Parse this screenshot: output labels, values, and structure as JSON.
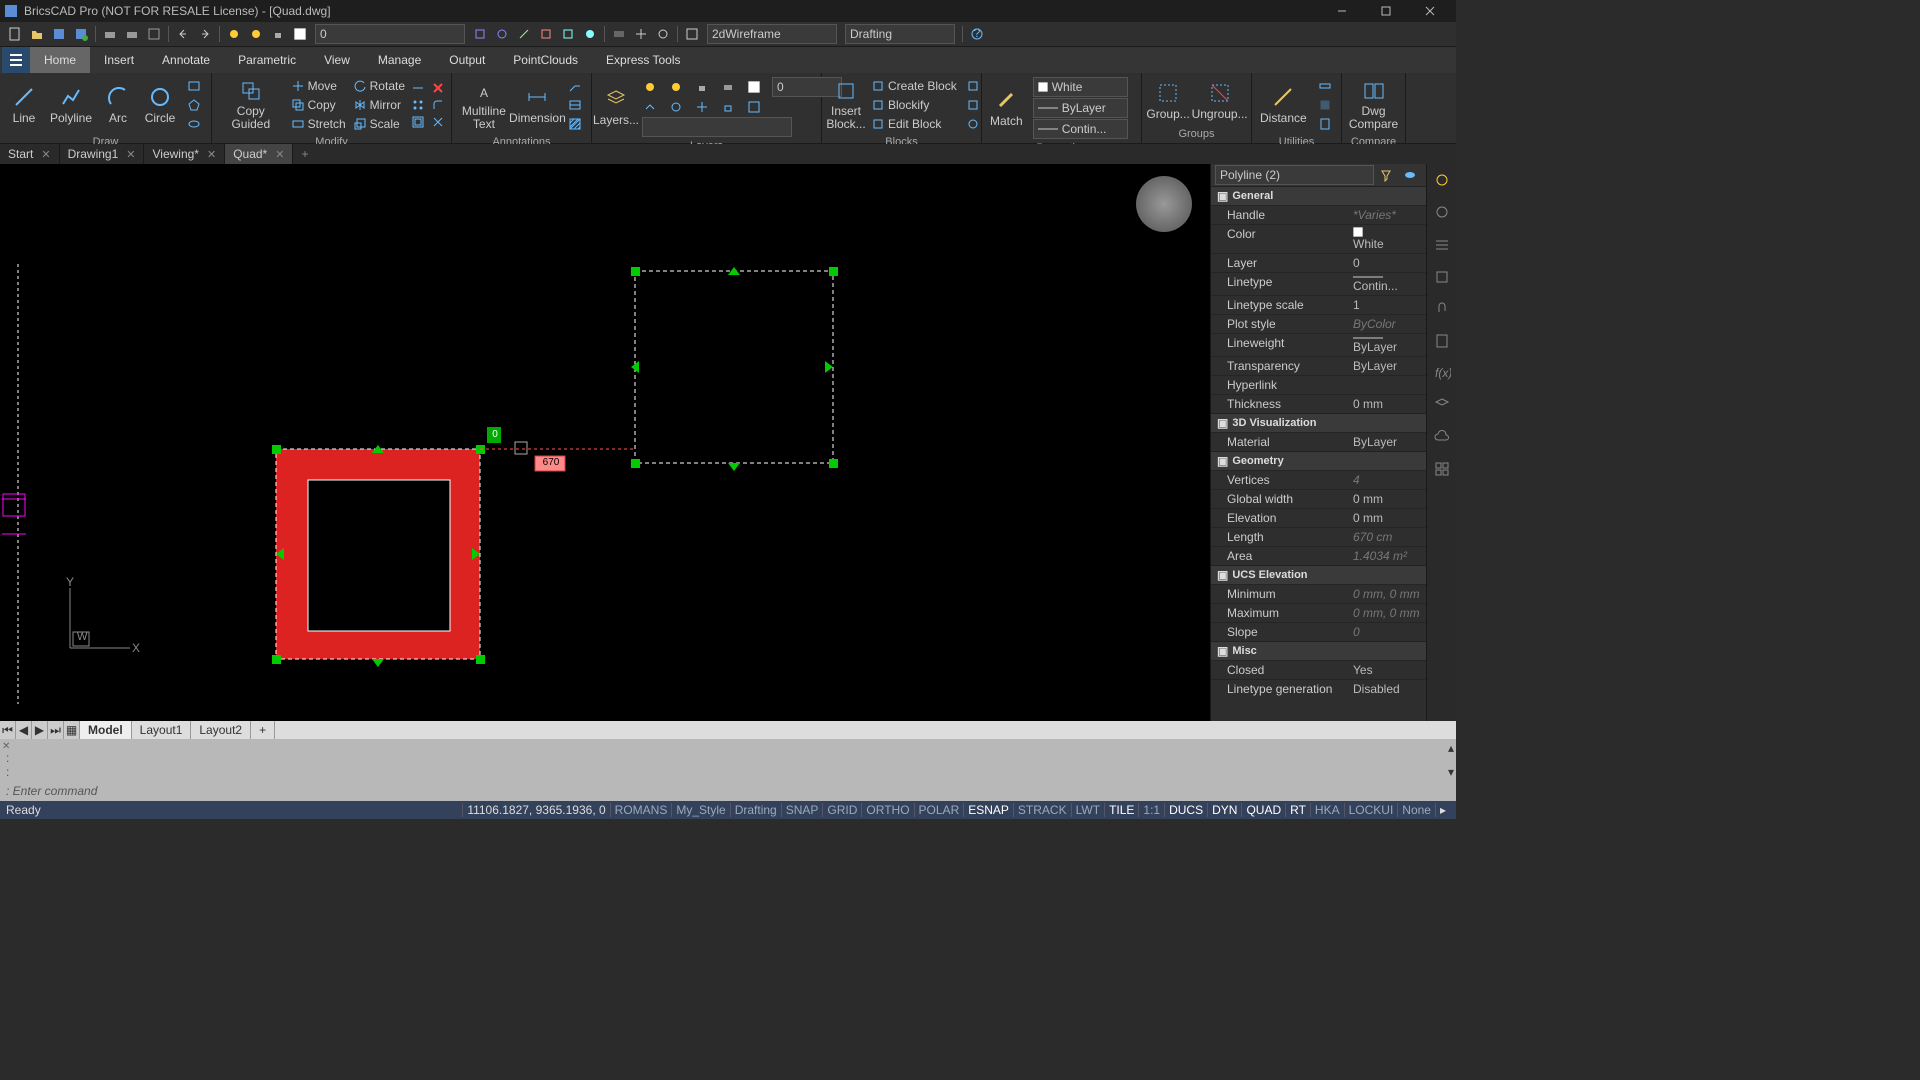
{
  "title": "BricsCAD Pro (NOT FOR RESALE License) - [Quad.dwg]",
  "qat": {
    "layer_dd": "0",
    "visual_style": "2dWireframe",
    "workspace": "Drafting"
  },
  "menus": [
    "Home",
    "Insert",
    "Annotate",
    "Parametric",
    "View",
    "Manage",
    "Output",
    "PointClouds",
    "Express Tools"
  ],
  "ribbon": {
    "draw": {
      "title": "Draw",
      "line": "Line",
      "polyline": "Polyline",
      "arc": "Arc",
      "circle": "Circle"
    },
    "modify": {
      "title": "Modify",
      "guided": "Copy Guided",
      "move": "Move",
      "rotate": "Rotate",
      "copy": "Copy",
      "mirror": "Mirror",
      "stretch": "Stretch",
      "scale": "Scale"
    },
    "annot": {
      "title": "Annotations",
      "mtext": "Multiline Text",
      "dim": "Dimension"
    },
    "layers": {
      "title": "Layers",
      "btn": "Layers...",
      "dd": "0"
    },
    "blocks": {
      "title": "Blocks",
      "insert": "Insert Block...",
      "create": "Create Block",
      "blockify": "Blockify",
      "edit": "Edit Block"
    },
    "match": {
      "label": "Match"
    },
    "props": {
      "title": "Properties",
      "color": "White",
      "ltype": "ByLayer",
      "lstyle": "Contin..."
    },
    "groups": {
      "title": "Groups",
      "group": "Group...",
      "ungroup": "Ungroup..."
    },
    "util": {
      "title": "Utilities",
      "distance": "Distance"
    },
    "compare": {
      "title": "Compare",
      "dwg": "Dwg Compare"
    }
  },
  "doc_tabs": [
    {
      "label": "Start",
      "closeable": true
    },
    {
      "label": "Drawing1",
      "closeable": true
    },
    {
      "label": "Viewing*",
      "closeable": true
    },
    {
      "label": "Quad*",
      "closeable": true,
      "active": true
    }
  ],
  "canvas": {
    "input_val": "0",
    "meas_val": "670",
    "ucs_label": "W"
  },
  "props": {
    "selection": "Polyline (2)",
    "groups": [
      {
        "name": "General",
        "rows": [
          {
            "k": "Handle",
            "v": "*Varies*",
            "varies": true
          },
          {
            "k": "Color",
            "v": "White",
            "swatch": true
          },
          {
            "k": "Layer",
            "v": "0"
          },
          {
            "k": "Linetype",
            "v": "Contin..."
          },
          {
            "k": "Linetype scale",
            "v": "1"
          },
          {
            "k": "Plot style",
            "v": "ByColor",
            "varies": true
          },
          {
            "k": "Lineweight",
            "v": "ByLayer"
          },
          {
            "k": "Transparency",
            "v": "ByLayer"
          },
          {
            "k": "Hyperlink",
            "v": ""
          },
          {
            "k": "Thickness",
            "v": "0 mm"
          }
        ]
      },
      {
        "name": "3D Visualization",
        "rows": [
          {
            "k": "Material",
            "v": "ByLayer"
          }
        ]
      },
      {
        "name": "Geometry",
        "rows": [
          {
            "k": "Vertices",
            "v": "4",
            "varies": true
          },
          {
            "k": "Global width",
            "v": "0 mm"
          },
          {
            "k": "Elevation",
            "v": "0 mm"
          },
          {
            "k": "Length",
            "v": "670 cm",
            "varies": true
          },
          {
            "k": "Area",
            "v": "1.4034 m²",
            "varies": true
          }
        ]
      },
      {
        "name": "UCS Elevation",
        "rows": [
          {
            "k": "Minimum",
            "v": "0 mm, 0 mm",
            "varies": true
          },
          {
            "k": "Maximum",
            "v": "0 mm, 0 mm",
            "varies": true
          },
          {
            "k": "Slope",
            "v": "0",
            "varies": true
          }
        ]
      },
      {
        "name": "Misc",
        "rows": [
          {
            "k": "Closed",
            "v": "Yes"
          },
          {
            "k": "Linetype generation",
            "v": "Disabled"
          }
        ]
      }
    ]
  },
  "layout_tabs": [
    "Model",
    "Layout1",
    "Layout2"
  ],
  "cmd": {
    "history_lines": [
      ":",
      ":"
    ],
    "prompt": ": Enter command"
  },
  "status": {
    "left": "Ready",
    "coords": "11106.1827, 9365.1936, 0",
    "cells": [
      "ROMANS",
      "My_Style",
      "Drafting",
      "SNAP",
      "GRID",
      "ORTHO",
      "POLAR",
      "ESNAP",
      "STRACK",
      "LWT",
      "TILE",
      "1:1",
      "DUCS",
      "DYN",
      "QUAD",
      "RT",
      "HKA",
      "LOCKUI",
      "None"
    ]
  }
}
